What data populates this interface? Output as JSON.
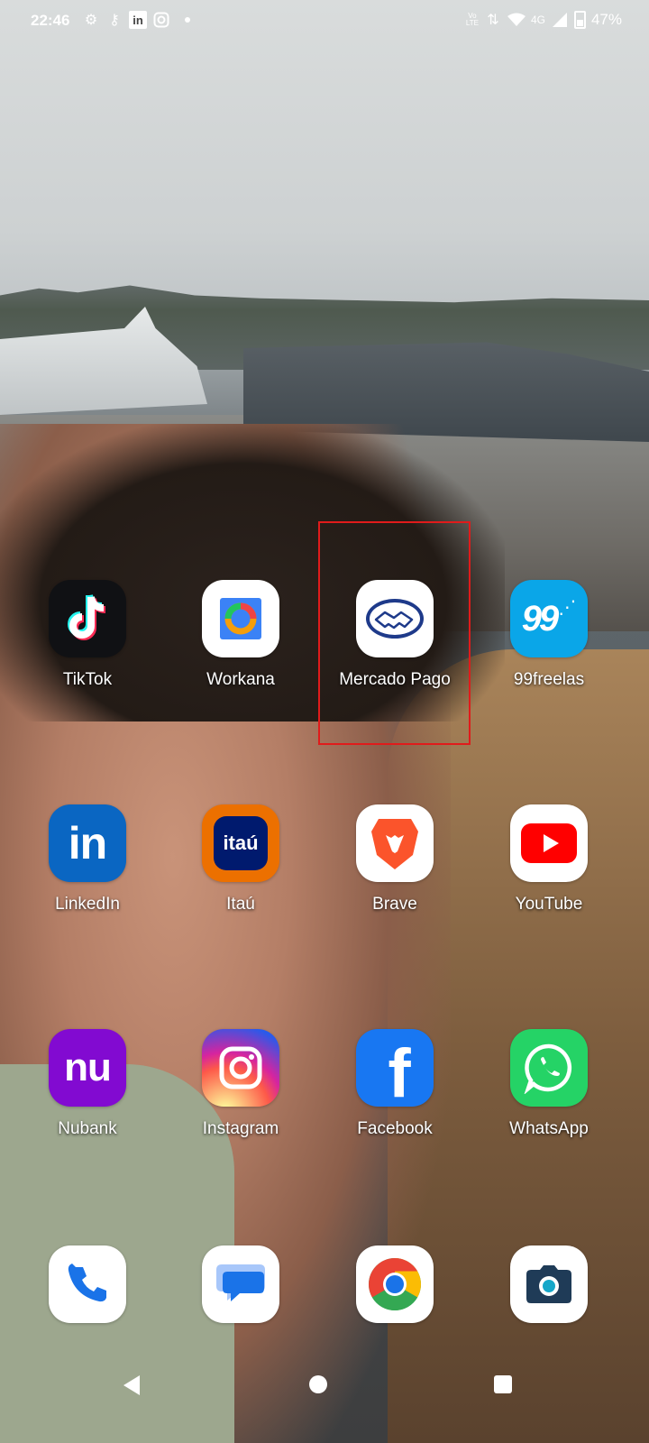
{
  "status_bar": {
    "time": "22:46",
    "left_icons": [
      "settings-gear-icon",
      "vpn-key-icon",
      "linkedin-icon",
      "instagram-icon",
      "dot-icon"
    ],
    "network": "4G",
    "volte": "Vo\nLTE",
    "battery_percent": "47%"
  },
  "apps": [
    {
      "id": "tiktok",
      "label": "TikTok",
      "icon": "tiktok-icon",
      "bg": "#101114"
    },
    {
      "id": "workana",
      "label": "Workana",
      "icon": "workana-icon",
      "bg": "#ffffff"
    },
    {
      "id": "mercado-pago",
      "label": "Mercado Pago",
      "icon": "handshake-icon",
      "bg": "#ffffff",
      "highlighted": true
    },
    {
      "id": "99freelas",
      "label": "99freelas",
      "icon": "99freelas-icon",
      "bg": "#0aa6e8"
    },
    {
      "id": "linkedin",
      "label": "LinkedIn",
      "icon": "linkedin-icon",
      "bg": "#0a66c2"
    },
    {
      "id": "itau",
      "label": "Itaú",
      "icon": "itau-icon",
      "bg": "#ec7000"
    },
    {
      "id": "brave",
      "label": "Brave",
      "icon": "brave-lion-icon",
      "bg": "#ffffff"
    },
    {
      "id": "youtube",
      "label": "YouTube",
      "icon": "youtube-play-icon",
      "bg": "#ffffff"
    },
    {
      "id": "nubank",
      "label": "Nubank",
      "icon": "nubank-icon",
      "bg": "#820ad1"
    },
    {
      "id": "instagram",
      "label": "Instagram",
      "icon": "instagram-icon",
      "bg": "#d62976"
    },
    {
      "id": "facebook",
      "label": "Facebook",
      "icon": "facebook-icon",
      "bg": "#1877f2"
    },
    {
      "id": "whatsapp",
      "label": "WhatsApp",
      "icon": "whatsapp-icon",
      "bg": "#25d366"
    }
  ],
  "dock": [
    {
      "id": "phone",
      "icon": "phone-icon",
      "bg": "#ffffff"
    },
    {
      "id": "messages",
      "icon": "messages-icon",
      "bg": "#ffffff"
    },
    {
      "id": "chrome",
      "icon": "chrome-icon",
      "bg": "#ffffff"
    },
    {
      "id": "camera",
      "icon": "camera-icon",
      "bg": "#ffffff"
    }
  ],
  "nav": {
    "back": "back-icon",
    "home": "home-icon",
    "recents": "recents-icon"
  },
  "colors": {
    "highlight_box": "#e01b1b",
    "label_text": "#ffffff"
  }
}
